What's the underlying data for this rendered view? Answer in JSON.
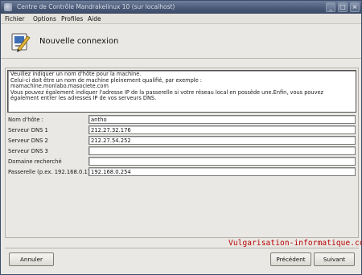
{
  "window": {
    "title": "Centre de Contrôle Mandrakelinux 10 (sur localhost)",
    "minimize_glyph": "_",
    "maximize_glyph": "□",
    "close_glyph": "×"
  },
  "menubar": {
    "items": [
      "Fichier",
      "Options",
      "Profiles",
      "Aide"
    ]
  },
  "banner": {
    "title": "Nouvelle connexion",
    "icon": "network-wizard-icon"
  },
  "info": {
    "lines": [
      "Veuillez indiquer un nom d'hôte pour la machine.",
      "Celui-ci doit être un nom de machine pleinement qualifié, par exemple :",
      "mamachine.monlabo.masociete.com",
      "Vous pouvez également indiquer l'adresse IP de la passerelle si votre réseau local en possède une.Enfin, vous pouvez",
      "également entrer les adresses IP de vos serveurs DNS."
    ]
  },
  "form": {
    "hostname": {
      "label": "Nom d'hôte :",
      "value": "antho"
    },
    "dns1": {
      "label": "Serveur DNS 1",
      "value": "212.27.32.176"
    },
    "dns2": {
      "label": "Serveur DNS 2",
      "value": "212.27.54.252"
    },
    "dns3": {
      "label": "Serveur DNS 3",
      "value": ""
    },
    "search_domain": {
      "label": "Domaine recherché",
      "value": ""
    },
    "gateway": {
      "label": "Passerelle (p.ex. 192.168.0.1)",
      "value": "192.168.0.254"
    }
  },
  "watermark": "Vulgarisation-informatique.com",
  "buttons": {
    "cancel": "Annuler",
    "previous": "Précédent",
    "next": "Suivant"
  },
  "colors": {
    "titlebar": "#4a5a78",
    "watermark": "#b80000"
  }
}
